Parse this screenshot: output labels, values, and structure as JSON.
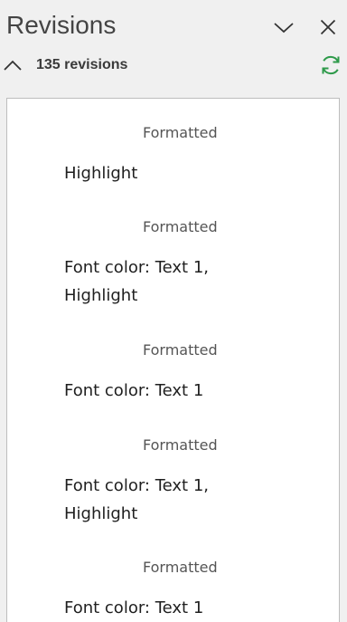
{
  "pane": {
    "title": "Revisions",
    "options_icon": "chevron-down-icon",
    "close_icon": "close-icon"
  },
  "summary": {
    "count_label": "135 revisions",
    "collapse_icon": "chevron-up-icon",
    "refresh_icon": "refresh-icon",
    "refresh_color": "#2e9a4a"
  },
  "revisions": [
    {
      "type": "Formatted",
      "description": "Highlight"
    },
    {
      "type": "Formatted",
      "description": "Font color: Text 1, Highlight"
    },
    {
      "type": "Formatted",
      "description": "Font color: Text 1"
    },
    {
      "type": "Formatted",
      "description": "Font color: Text 1, Highlight"
    },
    {
      "type": "Formatted",
      "description": "Font color: Text 1"
    }
  ]
}
